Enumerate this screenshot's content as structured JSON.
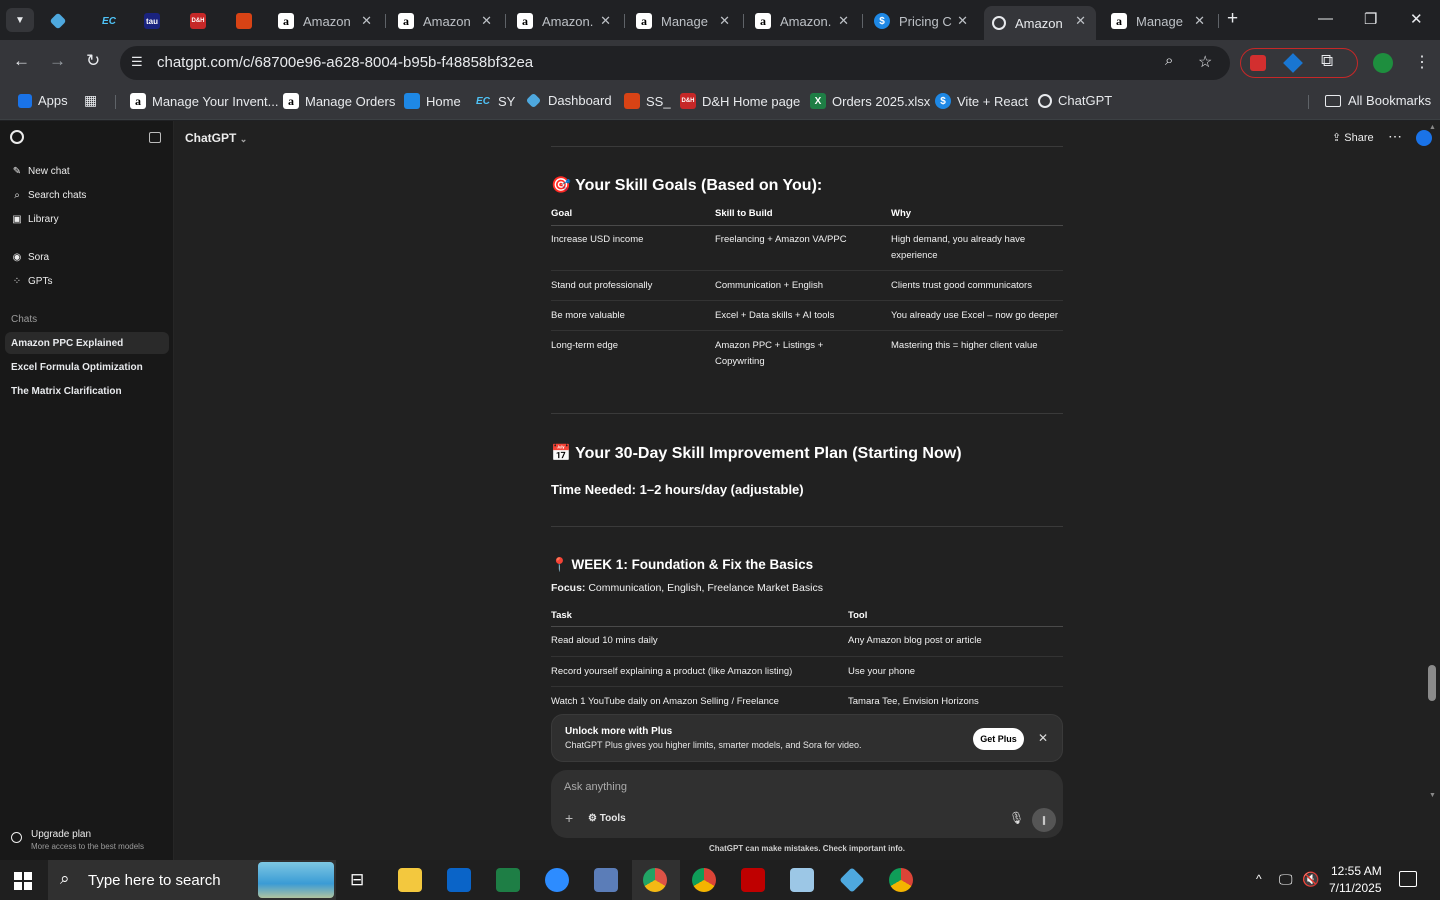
{
  "browser": {
    "tabs": [
      {
        "title": ""
      },
      {
        "title": ""
      },
      {
        "title": ""
      },
      {
        "title": ""
      },
      {
        "title": ""
      },
      {
        "title": "Amazon"
      },
      {
        "title": "Amazon"
      },
      {
        "title": "Amazon."
      },
      {
        "title": "Manage"
      },
      {
        "title": "Amazon."
      },
      {
        "title": "Pricing C"
      },
      {
        "title": "Amazon"
      },
      {
        "title": "Manage"
      }
    ],
    "url": "chatgpt.com/c/68700e96-a628-8004-b95b-f48858bf32ea",
    "bookmarks": [
      {
        "label": "Apps"
      },
      {
        "label": "Manage Your Invent..."
      },
      {
        "label": "Manage Orders"
      },
      {
        "label": "Home"
      },
      {
        "label": "SY"
      },
      {
        "label": "Dashboard"
      },
      {
        "label": "SS_"
      },
      {
        "label": "D&H Home page"
      },
      {
        "label": "Orders 2025.xlsx"
      },
      {
        "label": "Vite + React"
      },
      {
        "label": "ChatGPT"
      }
    ],
    "all_bookmarks": "All Bookmarks",
    "fav_text": {
      "ec": "EC",
      "tau": "tau",
      "dh": "D&H",
      "x": "X",
      "s": "$"
    }
  },
  "sidebar": {
    "new_chat": "New chat",
    "search": "Search chats",
    "library": "Library",
    "sora": "Sora",
    "gpts": "GPTs",
    "chats_label": "Chats",
    "chats": [
      "Amazon PPC Explained",
      "Excel Formula Optimization",
      "The Matrix Clarification"
    ],
    "upgrade_title": "Upgrade plan",
    "upgrade_sub": "More access to the best models"
  },
  "header": {
    "model": "ChatGPT",
    "share": "Share"
  },
  "content": {
    "goals_title": "🎯 Your Skill Goals (Based on You):",
    "goals_headers": [
      "Goal",
      "Skill to Build",
      "Why"
    ],
    "goals_rows": [
      [
        "Increase USD income",
        "Freelancing + Amazon VA/PPC",
        "High demand, you already have experience"
      ],
      [
        "Stand out professionally",
        "Communication + English",
        "Clients trust good communicators"
      ],
      [
        "Be more valuable",
        "Excel + Data skills + AI tools",
        "You already use Excel – now go deeper"
      ],
      [
        "Long-term edge",
        "Amazon PPC + Listings + Copywriting",
        "Mastering this = higher client value"
      ]
    ],
    "plan_title": "📅 Your 30-Day Skill Improvement Plan (Starting Now)",
    "time_needed": "Time Needed: 1–2 hours/day (adjustable)",
    "week1_title": "📍 WEEK 1: Foundation & Fix the Basics",
    "focus_label": "Focus:",
    "focus_text": "Communication, English, Freelance Market Basics",
    "week1_headers": [
      "Task",
      "Tool"
    ],
    "week1_rows": [
      [
        "Read aloud 10 mins daily",
        "Any Amazon blog post or article"
      ],
      [
        "Record yourself explaining a product (like Amazon listing)",
        "Use your phone"
      ],
      [
        "Watch 1 YouTube daily on Amazon Selling / Freelance",
        "Tamara Tee, Envision Horizons"
      ]
    ]
  },
  "banner": {
    "title": "Unlock more with Plus",
    "text": "ChatGPT Plus gives you higher limits, smarter models, and Sora for video.",
    "button": "Get Plus"
  },
  "composer": {
    "placeholder": "Ask anything",
    "tools": "Tools"
  },
  "disclaimer": "ChatGPT can make mistakes. Check important info.",
  "taskbar": {
    "search": "Type here to search",
    "time": "12:55 AM",
    "date": "7/11/2025"
  },
  "colors": {
    "accent_blue": "#1a73e8",
    "chatgpt_bg": "#212121",
    "sidebar_bg": "#181818"
  }
}
